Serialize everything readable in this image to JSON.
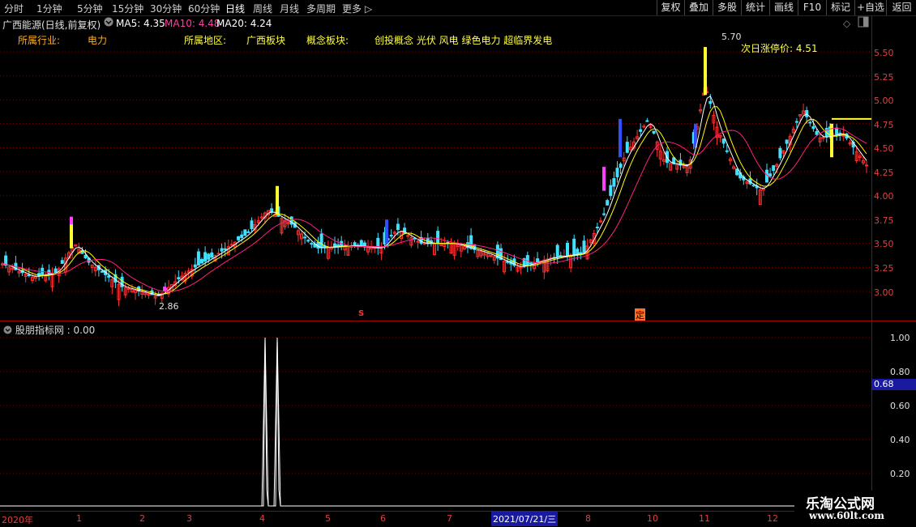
{
  "toolbar": {
    "periods": [
      "分时",
      "1分钟",
      "5分钟",
      "15分钟",
      "30分钟",
      "60分钟",
      "日线",
      "周线",
      "月线",
      "多周期",
      "更多 ▷"
    ],
    "active": "日线",
    "right_buttons": [
      "复权",
      "叠加",
      "多股",
      "统计",
      "画线",
      "F10",
      "标记",
      "+自选",
      "返回"
    ]
  },
  "header": {
    "stock": "广西能源(日线,前复权)",
    "ma5": "MA5: 4.35",
    "ma10": "MA10: 4.48",
    "ma20": "MA20: 4.24"
  },
  "info": {
    "industry_label": "所属行业:",
    "industry_value": "电力",
    "region_label": "所属地区:",
    "region_value": "广西板块",
    "concept_label": "概念板块:",
    "concept_value": "创投概念 光伏 风电 绿色电力 超临界发电",
    "next_limit": "次日涨停价: 4.51"
  },
  "price_axis": [
    "5.50",
    "5.25",
    "5.00",
    "4.75",
    "4.50",
    "4.25",
    "4.00",
    "3.75",
    "3.50",
    "3.25",
    "3.00"
  ],
  "annotations": {
    "high": "5.70",
    "low": "2.86",
    "mark_s": "S",
    "mark_ding": "定"
  },
  "indicator": {
    "title": "股朋指标网 : 0.00",
    "axis": [
      "1.00",
      "0.80",
      "0.60",
      "0.40",
      "0.20"
    ],
    "current": "0.68"
  },
  "date_axis": {
    "labels": [
      "2020年",
      "1",
      "2",
      "3",
      "4",
      "5",
      "6",
      "7",
      "8",
      "9",
      "10",
      "11",
      "12"
    ],
    "cursor": "2021/07/21/三"
  },
  "watermark": {
    "title": "乐淘公式网",
    "url": "www.60lt.com"
  },
  "colors": {
    "up": "#ff3030",
    "down": "#40e0ff",
    "ma5": "#ffffff",
    "ma10": "#ffff00",
    "ma20": "#ff2080",
    "grid": "#7a0000"
  }
}
